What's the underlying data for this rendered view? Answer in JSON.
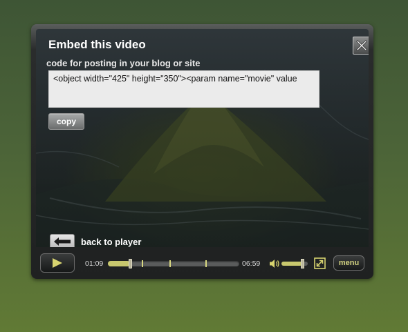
{
  "embed": {
    "title": "Embed this video",
    "subtitle": "code for posting in your blog or site",
    "code": "<object width=\"425\" height=\"350\"><param name=\"movie\" value",
    "copy_label": "copy",
    "back_label": "back to player"
  },
  "controls": {
    "current_time": "01:09",
    "total_time": "06:59",
    "progress_fraction": 0.17,
    "chapter_markers_fraction": [
      0.26,
      0.47,
      0.74
    ],
    "volume_fraction": 0.8,
    "menu_label": "menu"
  },
  "colors": {
    "accent": "#c8c86e",
    "page_background": "#4c6438"
  },
  "icons": {
    "close": "close-icon",
    "back": "back-arrow-icon",
    "play": "play-icon",
    "volume": "volume-icon",
    "fullscreen": "fullscreen-icon"
  }
}
